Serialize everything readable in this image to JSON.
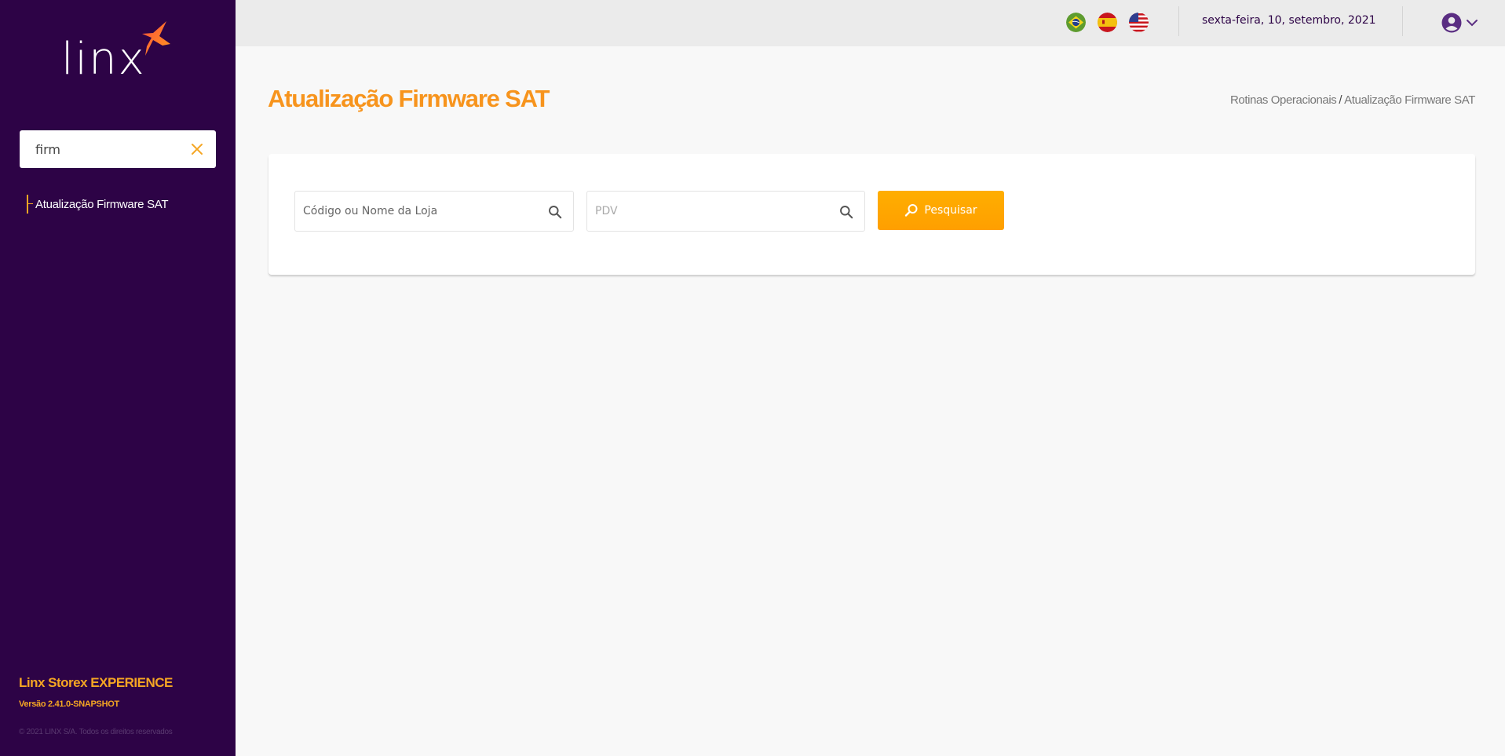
{
  "sidebar": {
    "logo_text": "linx",
    "search": {
      "value": "firm"
    },
    "menu": [
      {
        "label": "Atualização Firmware SAT"
      }
    ],
    "footer": {
      "product": "Linx Storex EXPERIENCE",
      "version": "Versão 2.41.0-SNAPSHOT",
      "copyright": "© 2021 LINX S/A. Todos os direitos reservados"
    }
  },
  "header": {
    "languages": [
      "Português (Brasil)",
      "Español",
      "English"
    ],
    "date": "sexta-feira, 10, setembro, 2021",
    "user_menu_icon": "user-circle-icon"
  },
  "main": {
    "title": "Atualização Firmware SAT",
    "breadcrumb": [
      "Rotinas Operacionais",
      "Atualização Firmware SAT"
    ],
    "breadcrumb_separator": "/",
    "filters": {
      "store_placeholder": "Código ou Nome da Loja",
      "pdv_placeholder": "PDV"
    },
    "search_button": "Pesquisar"
  },
  "colors": {
    "sidebar_bg": "#2d0346",
    "accent_orange": "#f7941d",
    "button_orange": "#ffa500",
    "topbar_bg": "#ebebeb"
  }
}
